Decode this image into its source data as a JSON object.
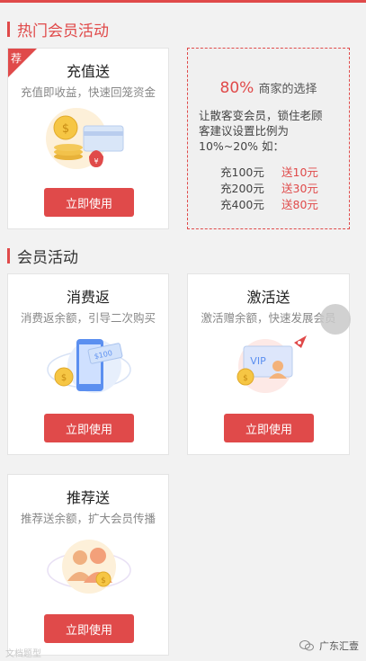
{
  "sections": {
    "hot": {
      "title": "热门会员活动"
    },
    "member": {
      "title": "会员活动"
    }
  },
  "cards": {
    "recharge": {
      "badge": "荐",
      "title": "充值送",
      "subtitle": "充值即收益，快速回笼资金",
      "button": "立即使用",
      "icon": "coins-card-icon"
    },
    "consume": {
      "title": "消费返",
      "subtitle": "消费返余额，引导二次购买",
      "button": "立即使用",
      "icon": "phone-cash-icon"
    },
    "activate": {
      "title": "激活送",
      "subtitle": "激活赠余额，快速发展会员",
      "button": "立即使用",
      "icon": "vip-card-icon"
    },
    "refer": {
      "title": "推荐送",
      "subtitle": "推荐送余额，扩大会员传播",
      "button": "立即使用",
      "icon": "people-coin-icon"
    }
  },
  "promo": {
    "percent": "80%",
    "percent_text": "商家的选择",
    "desc_line1": "让散客变会员，锁住老顾",
    "desc_line2": "客建议设置比例为",
    "desc_line3": "10%~20% 如：",
    "rows": [
      {
        "charge": "充100元",
        "give": "送10元"
      },
      {
        "charge": "充200元",
        "give": "送30元"
      },
      {
        "charge": "充400元",
        "give": "送80元"
      }
    ]
  },
  "watermarks": {
    "left": "文档题型",
    "right": "广东汇壹"
  },
  "colors": {
    "accent": "#e04a4a",
    "background": "#f2f2f2"
  }
}
